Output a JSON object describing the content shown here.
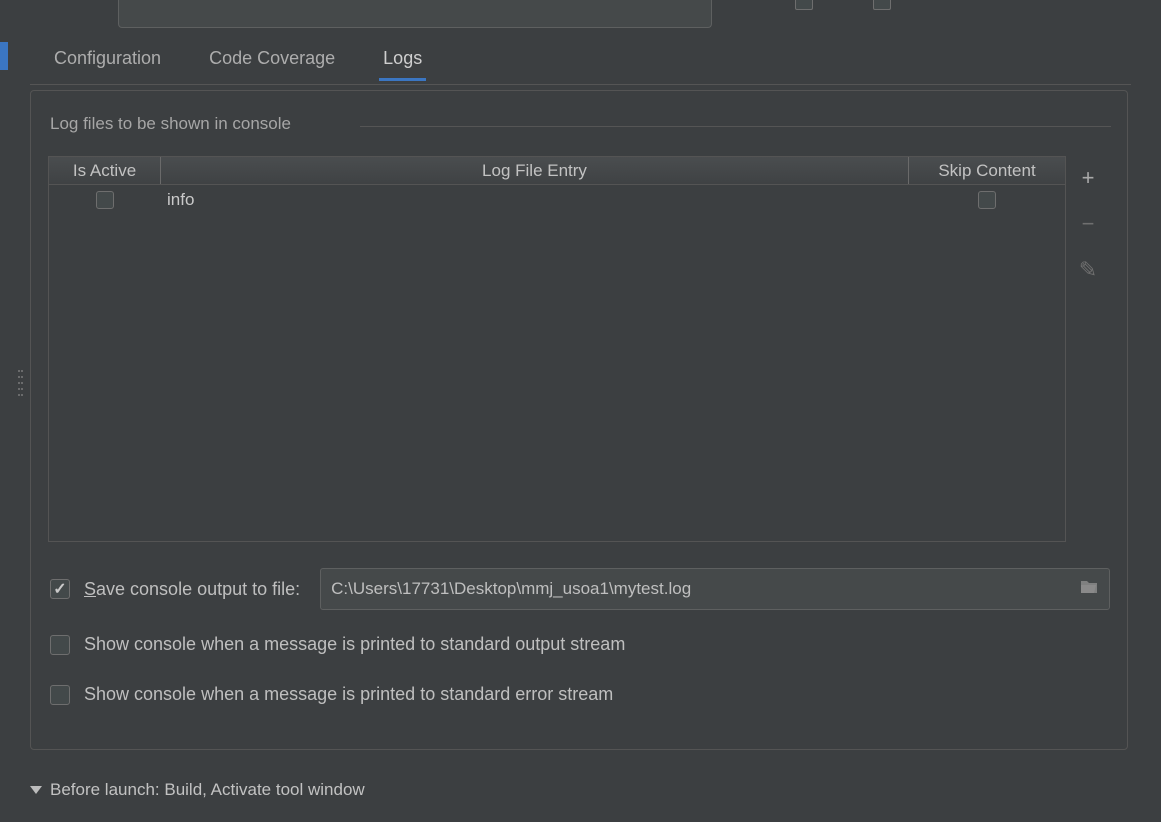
{
  "tabs": {
    "configuration": "Configuration",
    "coverage": "Code Coverage",
    "logs": "Logs"
  },
  "logs": {
    "fieldset_label": "Log files to be shown in console",
    "columns": {
      "active": "Is Active",
      "entry": "Log File Entry",
      "skip": "Skip Content"
    },
    "rows": [
      {
        "active": false,
        "entry": "info",
        "skip": false
      }
    ],
    "side_buttons": {
      "add": "+",
      "remove": "−",
      "edit": "✎"
    },
    "save_checkbox": true,
    "save_label_prefix": "S",
    "save_label_rest": "ave console output to file:",
    "save_path": "C:\\Users\\17731\\Desktop\\mmj_usoa1\\mytest.log",
    "opt_stdout_checked": false,
    "opt_stdout": "Show console when a message is printed to standard output stream",
    "opt_stderr_checked": false,
    "opt_stderr": "Show console when a message is printed to standard error stream"
  },
  "before_launch": "Before launch: Build, Activate tool window"
}
